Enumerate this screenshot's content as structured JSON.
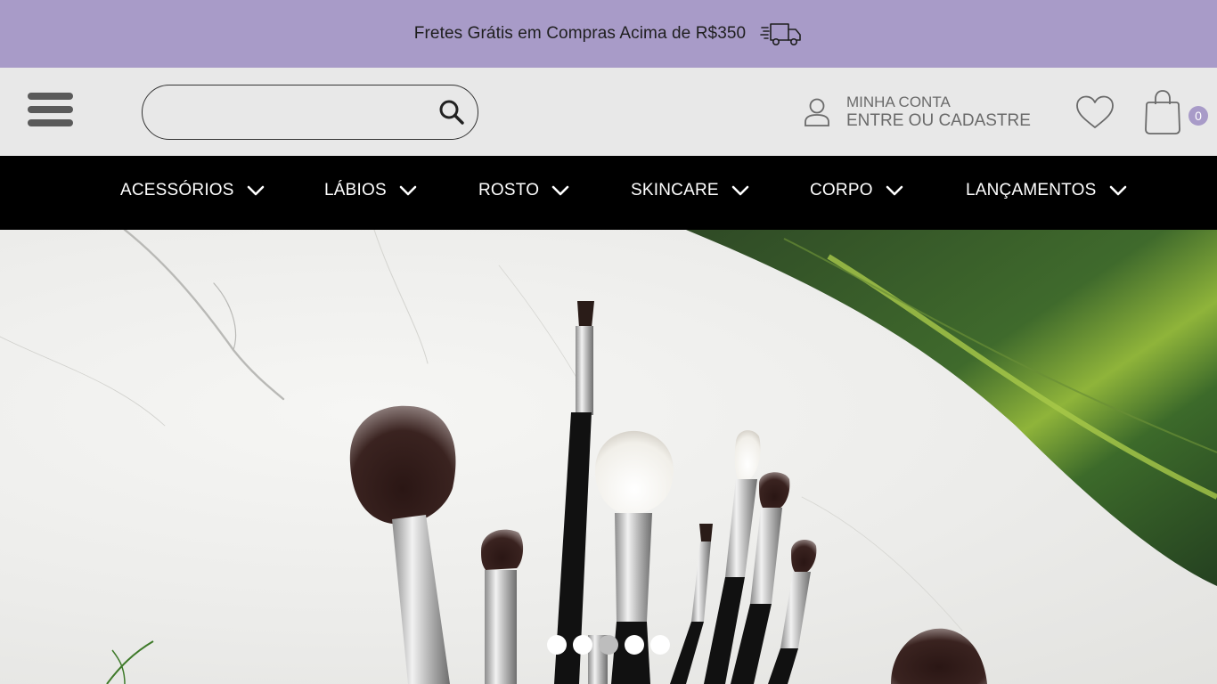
{
  "promo": {
    "text": "Fretes Grátis em Compras Acima de R$350",
    "icon": "fast-delivery-truck-icon"
  },
  "header": {
    "search": {
      "value": "",
      "placeholder": ""
    },
    "account": {
      "line1": "MINHA CONTA",
      "line2": "ENTRE OU CADASTRE"
    },
    "cart_count": "0"
  },
  "nav": {
    "items": [
      {
        "label": "ACESSÓRIOS"
      },
      {
        "label": "LÁBIOS"
      },
      {
        "label": "ROSTO"
      },
      {
        "label": "SKINCARE"
      },
      {
        "label": "CORPO"
      },
      {
        "label": "LANÇAMENTOS"
      }
    ]
  },
  "carousel": {
    "slide_count": 5,
    "active_index": 2
  },
  "colors": {
    "promo_bg": "#a89bc8",
    "header_bg": "#e8e8e8",
    "nav_bg": "#000000",
    "accent": "#a89bc8"
  }
}
